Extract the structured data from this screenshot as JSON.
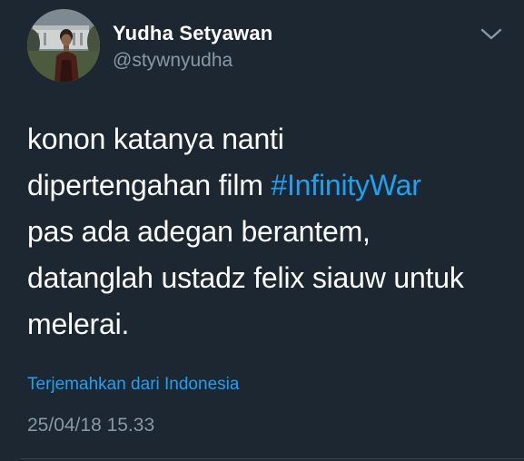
{
  "author": {
    "name": "Yudha Setyawan",
    "handle": "@stywnyudha",
    "avatar_icon": "profile-photo"
  },
  "tweet": {
    "lines": [
      [
        "konon katanya nanti"
      ],
      [
        "dipertengahan film ",
        "#InfinityWar"
      ],
      [
        "pas ada adegan berantem,"
      ],
      [
        "datanglah ustadz felix siauw untuk"
      ],
      [
        "melerai."
      ]
    ],
    "text_part1": "konon katanya nanti",
    "text_part2": "dipertengahan film ",
    "hashtag": "#InfinityWar",
    "text_part3": "pas ada adegan berantem,",
    "text_part4": "datanglah ustadz felix siauw untuk",
    "text_part5": "melerai.",
    "translate_link": "Terjemahkan dari Indonesia",
    "timestamp": "25/04/18 15.33"
  },
  "menu_icon": "chevron-down-icon",
  "colors": {
    "background": "#1c2732",
    "text": "#ffffff",
    "secondary": "#8899a6",
    "accent": "#1da1f2"
  }
}
